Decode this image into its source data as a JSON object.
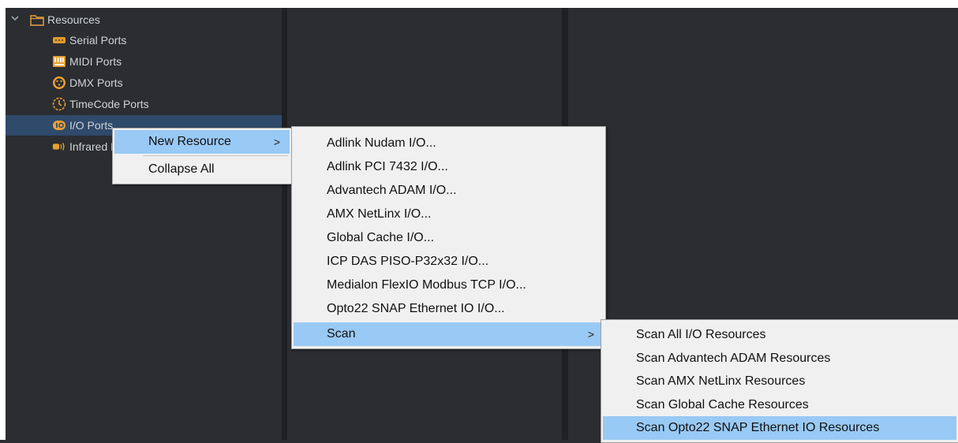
{
  "tree": {
    "root_label": "Resources",
    "items": [
      {
        "label": "Serial Ports",
        "icon": "serial-port-icon"
      },
      {
        "label": "MIDI Ports",
        "icon": "midi-port-icon"
      },
      {
        "label": "DMX Ports",
        "icon": "dmx-port-icon"
      },
      {
        "label": "TimeCode Ports",
        "icon": "timecode-icon"
      },
      {
        "label": "I/O Ports",
        "icon": "io-port-icon",
        "selected": true
      },
      {
        "label": "Infrared Ports",
        "icon": "infrared-icon"
      }
    ]
  },
  "context_menu": {
    "new_resource": "New Resource",
    "collapse_all": "Collapse All",
    "submenu_arrow": ">"
  },
  "new_resource_menu": {
    "items": [
      "Adlink Nudam I/O...",
      "Adlink PCI 7432 I/O...",
      "Advantech ADAM I/O...",
      "AMX NetLinx I/O...",
      "Global Cache I/O...",
      "ICP DAS PISO-P32x32 I/O...",
      "Medialon FlexIO Modbus TCP I/O...",
      "Opto22 SNAP Ethernet IO I/O..."
    ],
    "scan": "Scan"
  },
  "scan_menu": {
    "items": [
      "Scan All I/O Resources",
      "Scan Advantech ADAM Resources",
      "Scan AMX NetLinx Resources",
      "Scan Global Cache Resources",
      "Scan Opto22 SNAP Ethernet IO Resources"
    ],
    "highlighted_index": 4
  },
  "colors": {
    "background": "#2b2d31",
    "menu_bg": "#f0f0f0",
    "highlight": "#99c9f5",
    "selected_row": "#2f4a6b",
    "icon_orange": "#f0a030"
  }
}
